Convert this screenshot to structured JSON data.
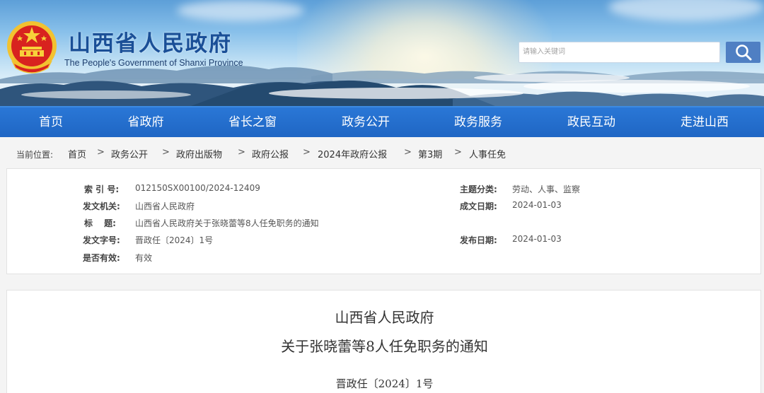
{
  "header": {
    "title": "山西省人民政府",
    "subtitle": "The People's Government of Shanxi Province",
    "emblem_icon": "national-emblem-icon",
    "search": {
      "placeholder": "请输入关键词",
      "button_icon": "search-icon"
    },
    "colors": {
      "title": "#1a4f97",
      "nav": "#1f66c4",
      "search_button": "#4f7fc3"
    }
  },
  "nav": {
    "items": [
      {
        "label": "首页"
      },
      {
        "label": "省政府"
      },
      {
        "label": "省长之窗"
      },
      {
        "label": "政务公开"
      },
      {
        "label": "政务服务"
      },
      {
        "label": "政民互动"
      },
      {
        "label": "走进山西"
      }
    ]
  },
  "breadcrumb": {
    "lead": "当前位置:",
    "separator": ">",
    "items": [
      {
        "label": "首页"
      },
      {
        "label": "政务公开"
      },
      {
        "label": "政府出版物"
      },
      {
        "label": "政府公报"
      },
      {
        "label": "2024年政府公报"
      },
      {
        "label": "第3期"
      },
      {
        "label": "人事任免"
      }
    ]
  },
  "info": {
    "index_label": "索 引 号:",
    "index_value": "012150SX00100/2024-12409",
    "issuer_label": "发文机关:",
    "issuer_value": "山西省人民政府",
    "title_label": "标　 题:",
    "title_value": "山西省人民政府关于张晓蕾等8人任免职务的通知",
    "docno_label": "发文字号:",
    "docno_value": "晋政任〔2024〕1号",
    "valid_label": "是否有效:",
    "valid_value": "有效",
    "category_label": "主题分类:",
    "category_value": "劳动、人事、监察",
    "created_label": "成文日期:",
    "created_value": "2024-01-03",
    "published_label": "发布日期:",
    "published_value": "2024-01-03"
  },
  "article": {
    "title_line1": "山西省人民政府",
    "title_line2": "关于张晓蕾等8人任免职务的通知",
    "doc_number": "晋政任〔2024〕1号"
  }
}
